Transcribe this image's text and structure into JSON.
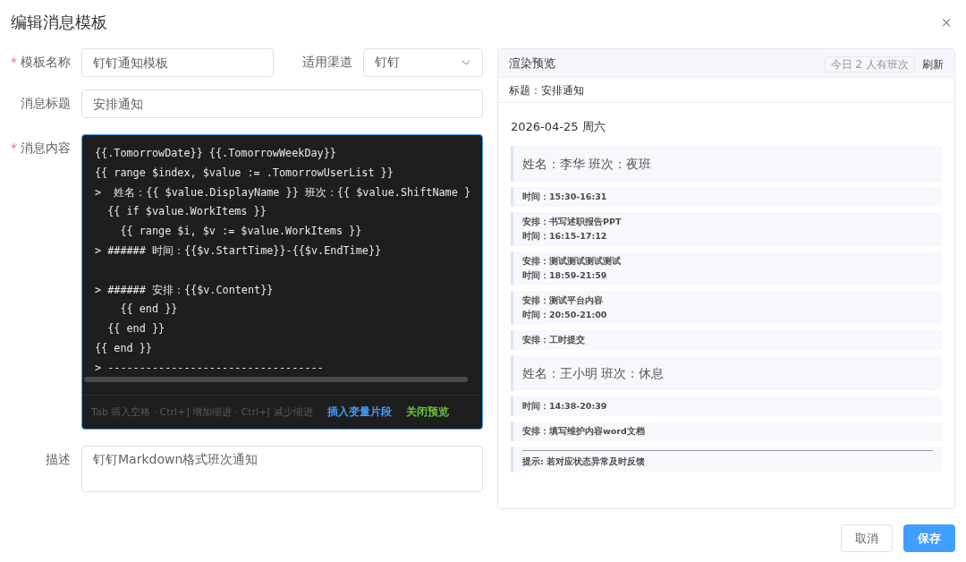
{
  "dialog": {
    "title": "编辑消息模板",
    "close": "×"
  },
  "form": {
    "name": {
      "label": "模板名称",
      "required_mark": "*",
      "value": "钉钉通知模板"
    },
    "channel": {
      "label": "适用渠道",
      "value": "钉钉"
    },
    "subject": {
      "label": "消息标题",
      "value": "安排通知"
    },
    "content": {
      "label": "消息内容",
      "required_mark": "*",
      "code": "{{.TomorrowDate}} {{.TomorrowWeekDay}}\n{{ range $index, $value := .TomorrowUserList }}\n>  姓名：{{ $value.DisplayName }} 班次：{{ $value.ShiftName }\n  {{ if $value.WorkItems }}\n    {{ range $i, $v := $value.WorkItems }}\n> ###### 时间：{{$v.StartTime}}-{{$v.EndTime}}\n\n> ###### 安排：{{$v.Content}}\n    {{ end }}\n  {{ end }}\n{{ end }}\n> ----------------------------------",
      "hint": "Tab 插入空格 · Ctrl+] 增加缩进 · Ctrl+[ 减少缩进",
      "insert_link": "插入变量片段",
      "preview_link": "关闭预览"
    },
    "description": {
      "label": "描述",
      "value": "钉钉Markdown格式班次通知"
    }
  },
  "preview": {
    "title": "渲染预览",
    "badge": "今日 2 人有班次",
    "refresh": "刷新",
    "subject": "标题：安排通知",
    "date": "2026-04-25 周六",
    "blocks": [
      {
        "kind": "person",
        "lines": [
          "姓名：李华 班次：夜班"
        ]
      },
      {
        "kind": "detail",
        "lines": [
          "时间：15:30-16:31"
        ]
      },
      {
        "kind": "detail",
        "lines": [
          "安排：书写述职报告PPT",
          "时间：16:15-17:12"
        ]
      },
      {
        "kind": "detail",
        "lines": [
          "安排：测试测试测试测试",
          "时间：18:59-21:59"
        ]
      },
      {
        "kind": "detail",
        "lines": [
          "安排：测试平台内容",
          "时间：20:50-21:00"
        ]
      },
      {
        "kind": "detail",
        "lines": [
          "安排：工时提交"
        ]
      },
      {
        "kind": "person",
        "lines": [
          "姓名：王小明 班次：休息"
        ]
      },
      {
        "kind": "detail",
        "lines": [
          "时间：14:38-20:39"
        ]
      },
      {
        "kind": "detail",
        "lines": [
          "安排：填写维护内容word文档"
        ]
      },
      {
        "kind": "tip",
        "lines": [
          "提示: 若对应状态异常及时反馈"
        ]
      }
    ]
  },
  "buttons": [
    {
      "label": "取消",
      "primary": false
    },
    {
      "label": "保存",
      "primary": true
    }
  ]
}
